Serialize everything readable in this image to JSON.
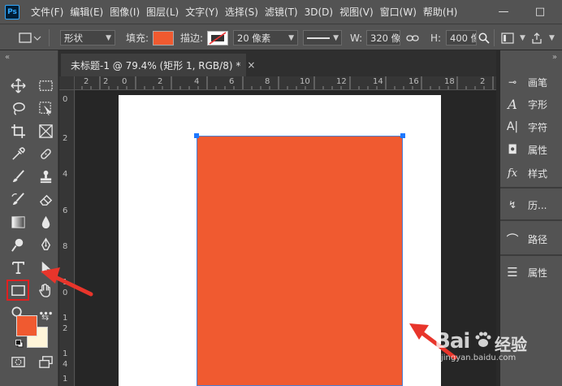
{
  "app": {
    "logo_text": "Ps",
    "menu": [
      "文件(F)",
      "编辑(E)",
      "图像(I)",
      "图层(L)",
      "文字(Y)",
      "选择(S)",
      "滤镜(T)",
      "3D(D)",
      "视图(V)",
      "窗口(W)",
      "帮助(H)"
    ],
    "window_controls": {
      "minimize": "—",
      "maximize": "□"
    }
  },
  "options_bar": {
    "mode": "形状",
    "fill_label": "填充:",
    "fill_color": "#f05a30",
    "stroke_label": "描边:",
    "stroke_width": "20 像素",
    "w_label": "W:",
    "w_value": "320 像",
    "h_label": "H:",
    "h_value": "400 像"
  },
  "document": {
    "tab_title": "未标题-1 @ 79.4% (矩形 1, RGB/8) *",
    "close": "×",
    "ruler_top": [
      "2",
      "2",
      "0",
      "2",
      "4",
      "6",
      "8",
      "10",
      "12",
      "14",
      "16",
      "18",
      "2"
    ],
    "ruler_left": [
      "0",
      "2",
      "4",
      "6",
      "8",
      "1",
      "0",
      "1",
      "2",
      "1",
      "4",
      "1"
    ],
    "shape_color": "#f05a30",
    "canvas_color": "#ffffff"
  },
  "toolbar": {
    "foreground_color": "#f05a30",
    "background_color": "#fff5d9"
  },
  "right_panel": {
    "items": [
      {
        "label": "画笔",
        "icon": "brush-settings-icon",
        "glyph": "⊸"
      },
      {
        "label": "字形",
        "icon": "glyphs-icon",
        "glyph": "A"
      },
      {
        "label": "字符",
        "icon": "character-icon",
        "glyph": "A|"
      },
      {
        "label": "属性",
        "icon": "properties-icon",
        "glyph": "◘"
      },
      {
        "label": "样式",
        "icon": "styles-icon",
        "glyph": "fx"
      },
      {
        "label": "历...",
        "icon": "history-icon",
        "glyph": "↯"
      },
      {
        "label": "路径",
        "icon": "paths-icon",
        "glyph": "⌒"
      },
      {
        "label": "属性",
        "icon": "adjust-properties-icon",
        "glyph": "☰"
      }
    ]
  },
  "watermark": {
    "text": "Bai",
    "suffix": "经验",
    "url": "jingyan.baidu.com"
  }
}
